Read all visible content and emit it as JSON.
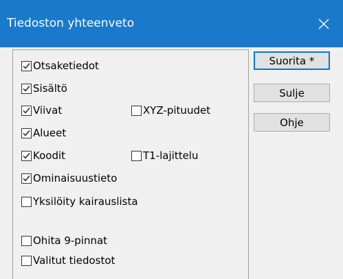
{
  "window": {
    "title": "Tiedoston yhteenveto"
  },
  "checkboxes": {
    "otsaketiedot": {
      "label": "Otsaketiedot",
      "checked": true
    },
    "sisalto": {
      "label": "Sisältö",
      "checked": true
    },
    "viivat": {
      "label": "Viivat",
      "checked": true
    },
    "xyz_pituudet": {
      "label": "XYZ-pituudet",
      "checked": false
    },
    "alueet": {
      "label": "Alueet",
      "checked": true
    },
    "koodit": {
      "label": "Koodit",
      "checked": true
    },
    "t1_lajittelu": {
      "label": "T1-lajittelu",
      "checked": false
    },
    "ominaisuustieto": {
      "label": "Ominaisuustieto",
      "checked": true
    },
    "yksiloity_kairauslista": {
      "label": "Yksilöity kairauslista",
      "checked": false
    },
    "ohita_9_pinnat": {
      "label": "Ohita 9-pinnat",
      "checked": false
    },
    "valitut_tiedostot": {
      "label": "Valitut tiedostot",
      "checked": false
    }
  },
  "buttons": {
    "suorita": "Suorita *",
    "sulje": "Sulje",
    "ohje": "Ohje"
  },
  "colors": {
    "titlebar": "#1979ca",
    "accent": "#0078d7",
    "dialog_bg": "#f0f0f0"
  }
}
